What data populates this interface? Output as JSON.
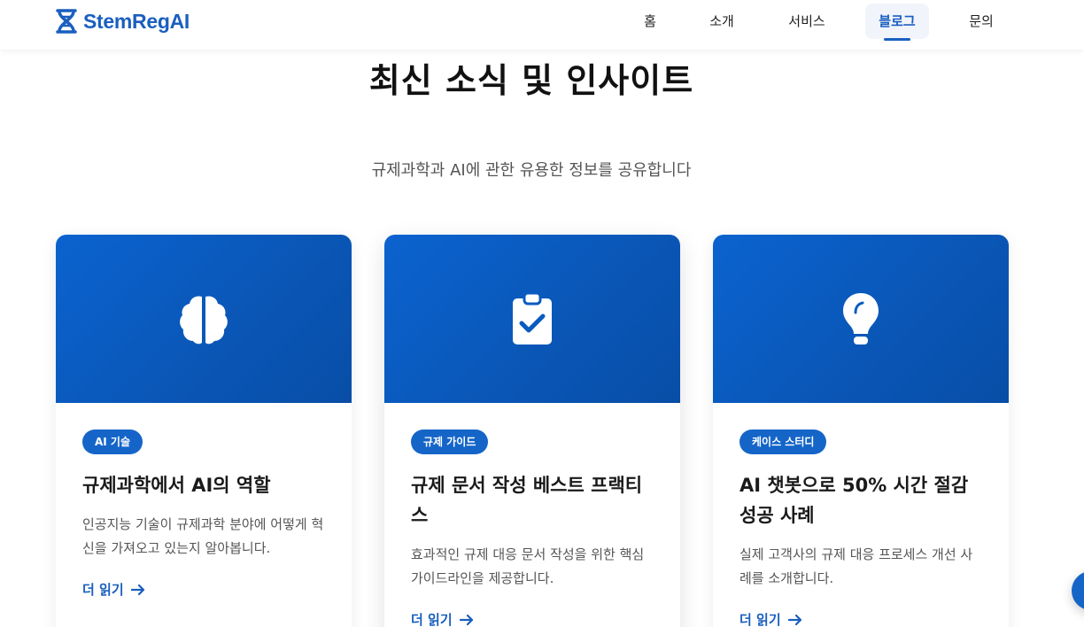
{
  "header": {
    "brand": "StemRegAI",
    "nav": [
      {
        "label": "홈"
      },
      {
        "label": "소개"
      },
      {
        "label": "서비스"
      },
      {
        "label": "블로그"
      },
      {
        "label": "문의"
      }
    ],
    "active_nav": "블로그"
  },
  "section": {
    "title": "최신 소식 및 인사이트",
    "subtitle": "규제과학과 AI에 관한 유용한 정보를 공유합니다"
  },
  "cards": [
    {
      "icon": "brain-icon",
      "badge": "AI 기술",
      "title": "규제과학에서 AI의 역할",
      "description": "인공지능 기술이 규제과학 분야에 어떻게 혁신을 가져오고 있는지 알아봅니다.",
      "read_more": "더 읽기"
    },
    {
      "icon": "clipboard-check-icon",
      "badge": "규제 가이드",
      "title": "규제 문서 작성 베스트 프랙티스",
      "description": "효과적인 규제 대응 문서 작성을 위한 핵심 가이드라인을 제공합니다.",
      "read_more": "더 읽기"
    },
    {
      "icon": "lightbulb-icon",
      "badge": "케이스 스터디",
      "title": "AI 챗봇으로 50% 시간 절감 성공 사례",
      "description": "실제 고객사의 규제 대응 프로세스 개선 사례를 소개합니다.",
      "read_more": "더 읽기"
    }
  ],
  "colors": {
    "brand": "#1a5fbf",
    "hero": "#0b63cf",
    "badge": "#1565c8"
  }
}
